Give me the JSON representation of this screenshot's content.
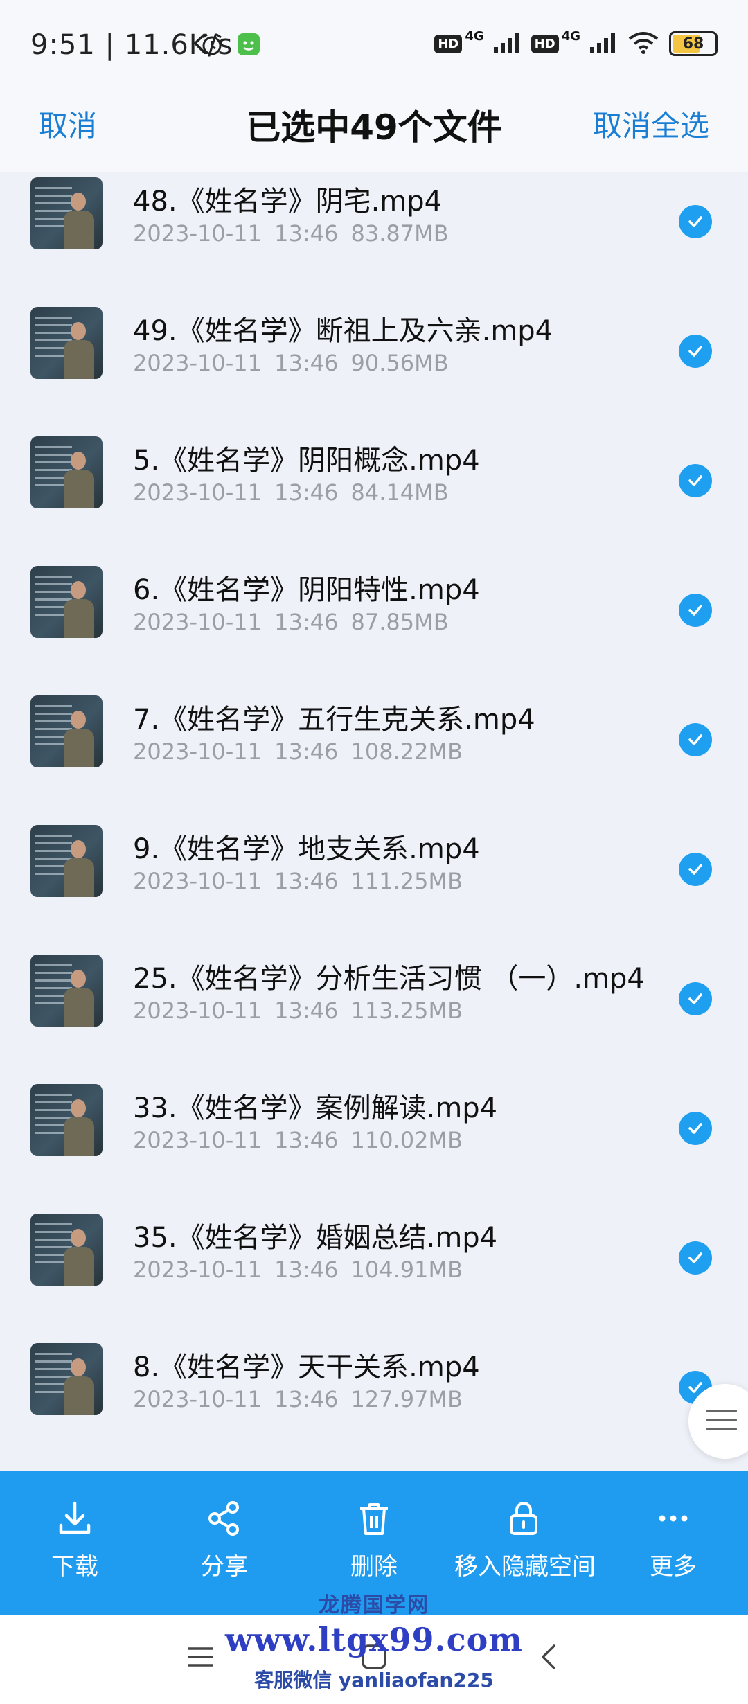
{
  "status_bar": {
    "time": "9:51",
    "speed": "11.6K/s",
    "hd1": "HD",
    "net1": "4G",
    "hd2": "HD",
    "net2": "4G",
    "battery": "68",
    "battery_level": 0.68,
    "battery_color": "#f3c542",
    "icons": [
      "alarm-icon",
      "app-notification-icon",
      "signal-icon",
      "wifi-icon",
      "battery-icon"
    ]
  },
  "header": {
    "cancel": "取消",
    "title": "已选中49个文件",
    "deselect_all": "取消全选"
  },
  "files": [
    {
      "name": "48.《姓名学》阴宅.mp4",
      "date": "2023-10-11",
      "time": "13:46",
      "size": "83.87MB",
      "selected": true
    },
    {
      "name": "49.《姓名学》断祖上及六亲.mp4",
      "date": "2023-10-11",
      "time": "13:46",
      "size": "90.56MB",
      "selected": true
    },
    {
      "name": "5.《姓名学》阴阳概念.mp4",
      "date": "2023-10-11",
      "time": "13:46",
      "size": "84.14MB",
      "selected": true
    },
    {
      "name": "6.《姓名学》阴阳特性.mp4",
      "date": "2023-10-11",
      "time": "13:46",
      "size": "87.85MB",
      "selected": true
    },
    {
      "name": "7.《姓名学》五行生克关系.mp4",
      "date": "2023-10-11",
      "time": "13:46",
      "size": "108.22MB",
      "selected": true
    },
    {
      "name": "9.《姓名学》地支关系.mp4",
      "date": "2023-10-11",
      "time": "13:46",
      "size": "111.25MB",
      "selected": true
    },
    {
      "name": "25.《姓名学》分析生活习惯 （一）.mp4",
      "date": "2023-10-11",
      "time": "13:46",
      "size": "113.25MB",
      "selected": true
    },
    {
      "name": "33.《姓名学》案例解读.mp4",
      "date": "2023-10-11",
      "time": "13:46",
      "size": "110.02MB",
      "selected": true
    },
    {
      "name": "35.《姓名学》婚姻总结.mp4",
      "date": "2023-10-11",
      "time": "13:46",
      "size": "104.91MB",
      "selected": true
    },
    {
      "name": "8.《姓名学》天干关系.mp4",
      "date": "2023-10-11",
      "time": "13:46",
      "size": "127.97MB",
      "selected": true
    }
  ],
  "actions": [
    {
      "label": "下载",
      "icon": "download-icon"
    },
    {
      "label": "分享",
      "icon": "share-icon"
    },
    {
      "label": "删除",
      "icon": "trash-icon"
    },
    {
      "label": "移入隐藏空间",
      "icon": "lock-icon"
    },
    {
      "label": "更多",
      "icon": "more-icon"
    }
  ],
  "watermark": {
    "title": "龙腾国学网",
    "url": "www.ltgx99.com",
    "contact": "客服微信 yanliaofan225"
  },
  "colors": {
    "accent": "#1a7fd4",
    "action_bar": "#1f9cf0",
    "check": "#1f9ff0",
    "list_background": "#eef1f8"
  }
}
